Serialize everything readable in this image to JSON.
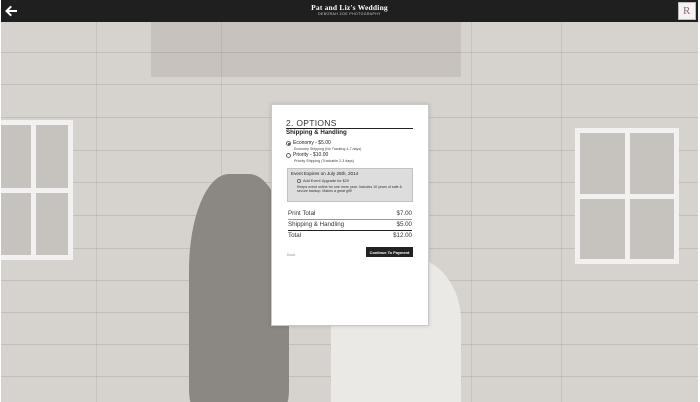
{
  "header": {
    "title": "Pat and Liz's Wedding",
    "subtitle": "DEBORAH ZOE PHOTOGRAPHY",
    "back_icon": "arrow-left-icon",
    "logo_icon": "brand-logo-icon",
    "logo_letter": "R",
    "bar_color": "#1f1f1f"
  },
  "dialog": {
    "step_title": "2. OPTIONS",
    "section_title": "Shipping & Handling",
    "shipping_options": [
      {
        "label": "Economy - $5.00",
        "description": "Economy Shipping (No Tracking 4-7 days)",
        "selected": true
      },
      {
        "label": "Priority - $10.00",
        "description": "Priority Shipping (Trackable 2-3 days)",
        "selected": false
      }
    ],
    "event": {
      "title": "Event Expires on July 25th, 2014",
      "upgrade_label": "Add Event Upgrade for $29",
      "upgrade_checked": false,
      "description": "Keeps event online for one more year. Includes 10 years of safe & secure backup. Makes a great gift!"
    },
    "totals": [
      {
        "label": "Print Total",
        "value": "$7.00"
      },
      {
        "label": "Shipping & Handling",
        "value": "$5.00"
      },
      {
        "label": "Total",
        "value": "$12.00"
      }
    ],
    "back_label": "Back",
    "continue_label": "Continue To Payment"
  }
}
